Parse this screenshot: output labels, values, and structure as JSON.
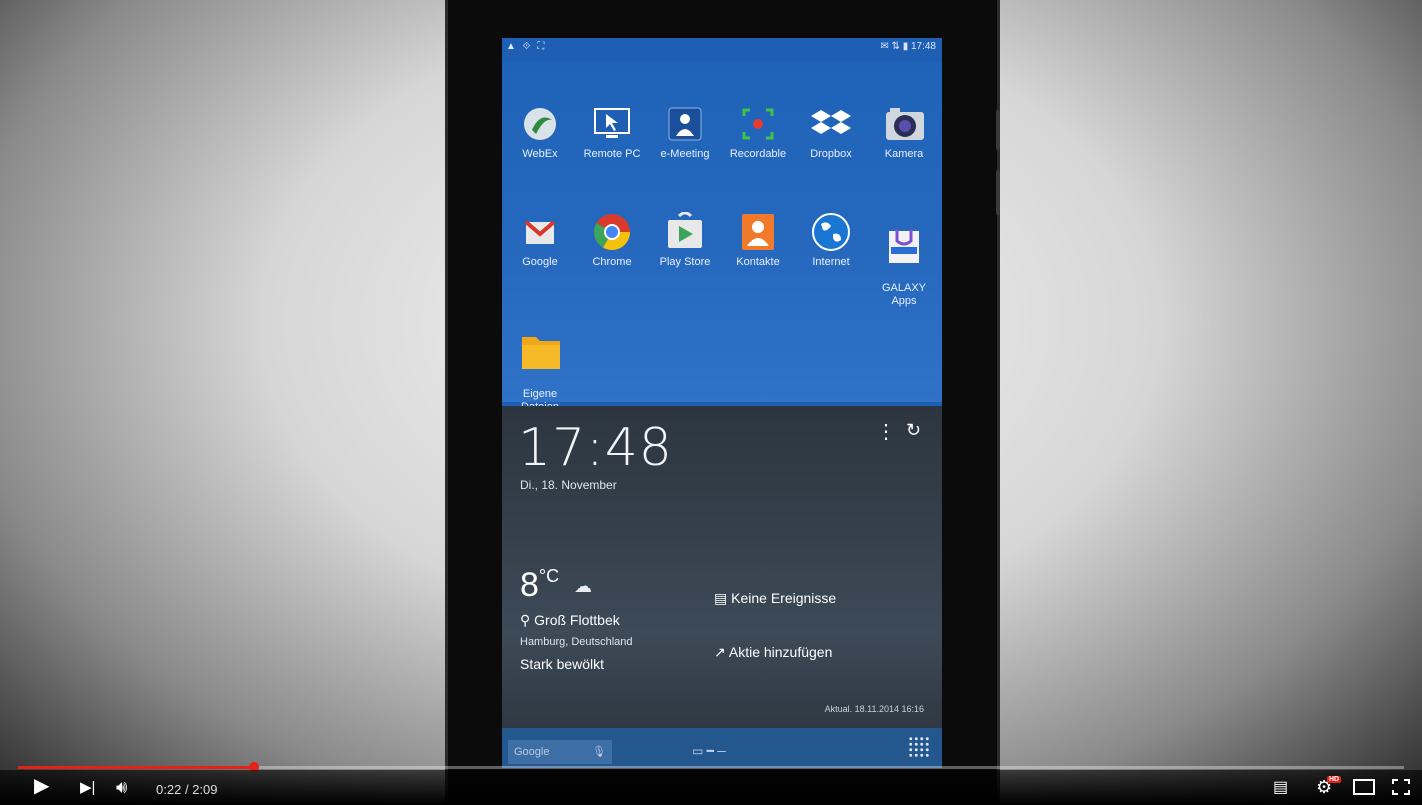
{
  "status": {
    "left_icons": "▲ ⟐ ⛶",
    "right": "✉ ⇅ ▮ 17:48"
  },
  "apps": [
    {
      "label": "WebEx",
      "icon": "webex-icon"
    },
    {
      "label": "Remote PC",
      "icon": "remote-pc-icon"
    },
    {
      "label": "e-Meeting",
      "icon": "e-meeting-icon"
    },
    {
      "label": "Recordable",
      "icon": "recordable-icon"
    },
    {
      "label": "Dropbox",
      "icon": "dropbox-icon"
    },
    {
      "label": "Kamera",
      "icon": "camera-icon"
    },
    {
      "label": "Google",
      "icon": "google-mail-icon"
    },
    {
      "label": "Chrome",
      "icon": "chrome-icon"
    },
    {
      "label": "Play Store",
      "icon": "play-store-icon"
    },
    {
      "label": "Kontakte",
      "icon": "contacts-icon"
    },
    {
      "label": "Internet",
      "icon": "internet-icon"
    },
    {
      "label": "GALAXY\nApps",
      "icon": "galaxy-apps-icon"
    },
    {
      "label": "Eigene\nDateien",
      "icon": "folder-icon"
    }
  ],
  "widget": {
    "time": "17:48",
    "date": "Di., 18. November",
    "temp": "8",
    "temp_unit": "°C",
    "location": "Groß Flottbek",
    "region": "Hamburg, Deutschland",
    "condition": "Stark bewölkt",
    "events": "Keine Ereignisse",
    "stock": "Aktie hinzufügen",
    "updated": "Aktual. 18.11.2014 16:16"
  },
  "dock": {
    "search_placeholder": "Google"
  },
  "player": {
    "current_time": "0:22",
    "separator": "/",
    "duration": "2:09",
    "progress_fraction": 0.17,
    "accent": "#e62117",
    "hd_badge": "HD"
  }
}
